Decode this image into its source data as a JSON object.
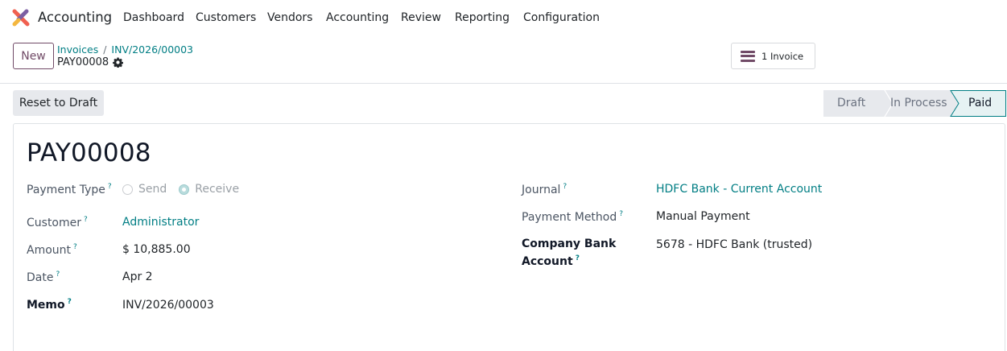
{
  "topnav": {
    "app_name": "Accounting",
    "menu": [
      "Dashboard",
      "Customers",
      "Vendors",
      "Accounting",
      "Review",
      "Reporting",
      "Configuration"
    ]
  },
  "control_panel": {
    "new_label": "New",
    "breadcrumbs": [
      "Invoices",
      "INV/2026/00003"
    ],
    "breadcrumb_separator": "/",
    "record_name": "PAY00008",
    "smart_button_label": "1 Invoice"
  },
  "actions": {
    "reset_label": "Reset to Draft"
  },
  "statusbar": {
    "stages": [
      "Draft",
      "In Process",
      "Paid"
    ],
    "active": "Paid"
  },
  "form": {
    "title": "PAY00008",
    "help_marker": "?",
    "left": {
      "payment_type_label": "Payment Type",
      "payment_type_options": [
        "Send",
        "Receive"
      ],
      "payment_type_selected": "Receive",
      "customer_label": "Customer",
      "customer_value": "Administrator",
      "amount_label": "Amount",
      "amount_value": "$ 10,885.00",
      "date_label": "Date",
      "date_value": "Apr 2",
      "memo_label": "Memo",
      "memo_value": "INV/2026/00003"
    },
    "right": {
      "journal_label": "Journal",
      "journal_value": "HDFC Bank - Current Account",
      "payment_method_label": "Payment Method",
      "payment_method_value": "Manual Payment",
      "company_bank_label_line1": "Company Bank",
      "company_bank_label_line2": "Account",
      "company_bank_value": "5678 - HDFC Bank (trusted)"
    }
  },
  "colors": {
    "brand": "#714b67",
    "link": "#017e84",
    "active_stage_bg": "#e6f2f3",
    "stage_bg": "#e7e9ed"
  }
}
